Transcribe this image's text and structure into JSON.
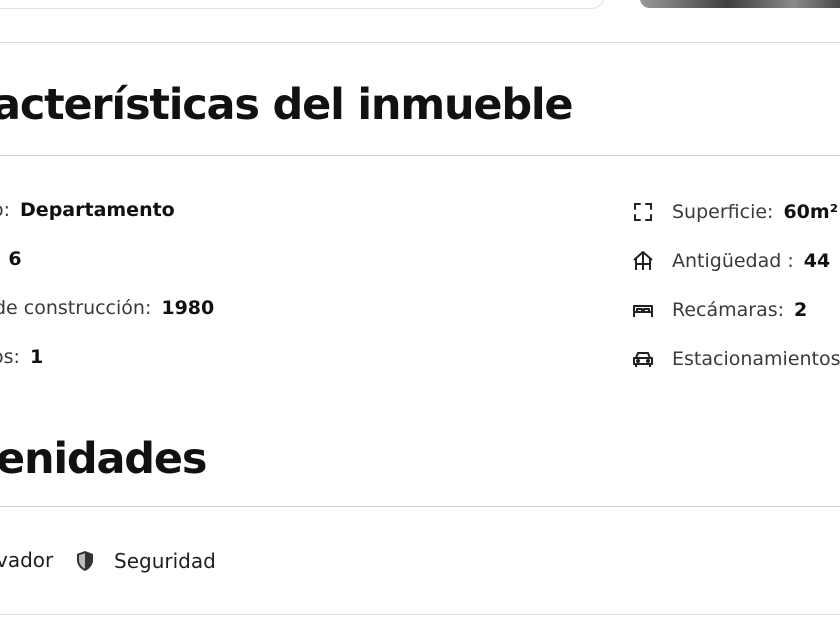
{
  "top": {},
  "caracteristicas": {
    "title": "acterísticas del inmueble",
    "left": [
      {
        "label": "o:",
        "value": "Departamento"
      },
      {
        "label": ":",
        "value": "6"
      },
      {
        "label": "de construcción:",
        "value": "1980"
      },
      {
        "label": "os:",
        "value": "1"
      }
    ],
    "right": [
      {
        "icon": "expand-corners-icon",
        "label": "Superficie:",
        "value": "60m²"
      },
      {
        "icon": "building-age-icon",
        "label": "Antigüedad :",
        "value": "44"
      },
      {
        "icon": "bed-icon",
        "label": "Recámaras:",
        "value": "2"
      },
      {
        "icon": "car-icon",
        "label": "Estacionamientos",
        "value": ""
      }
    ]
  },
  "amenidades": {
    "title": "enidades",
    "items": [
      {
        "label": "vador"
      },
      {
        "icon": "shield-icon",
        "label": "Seguridad"
      }
    ]
  }
}
